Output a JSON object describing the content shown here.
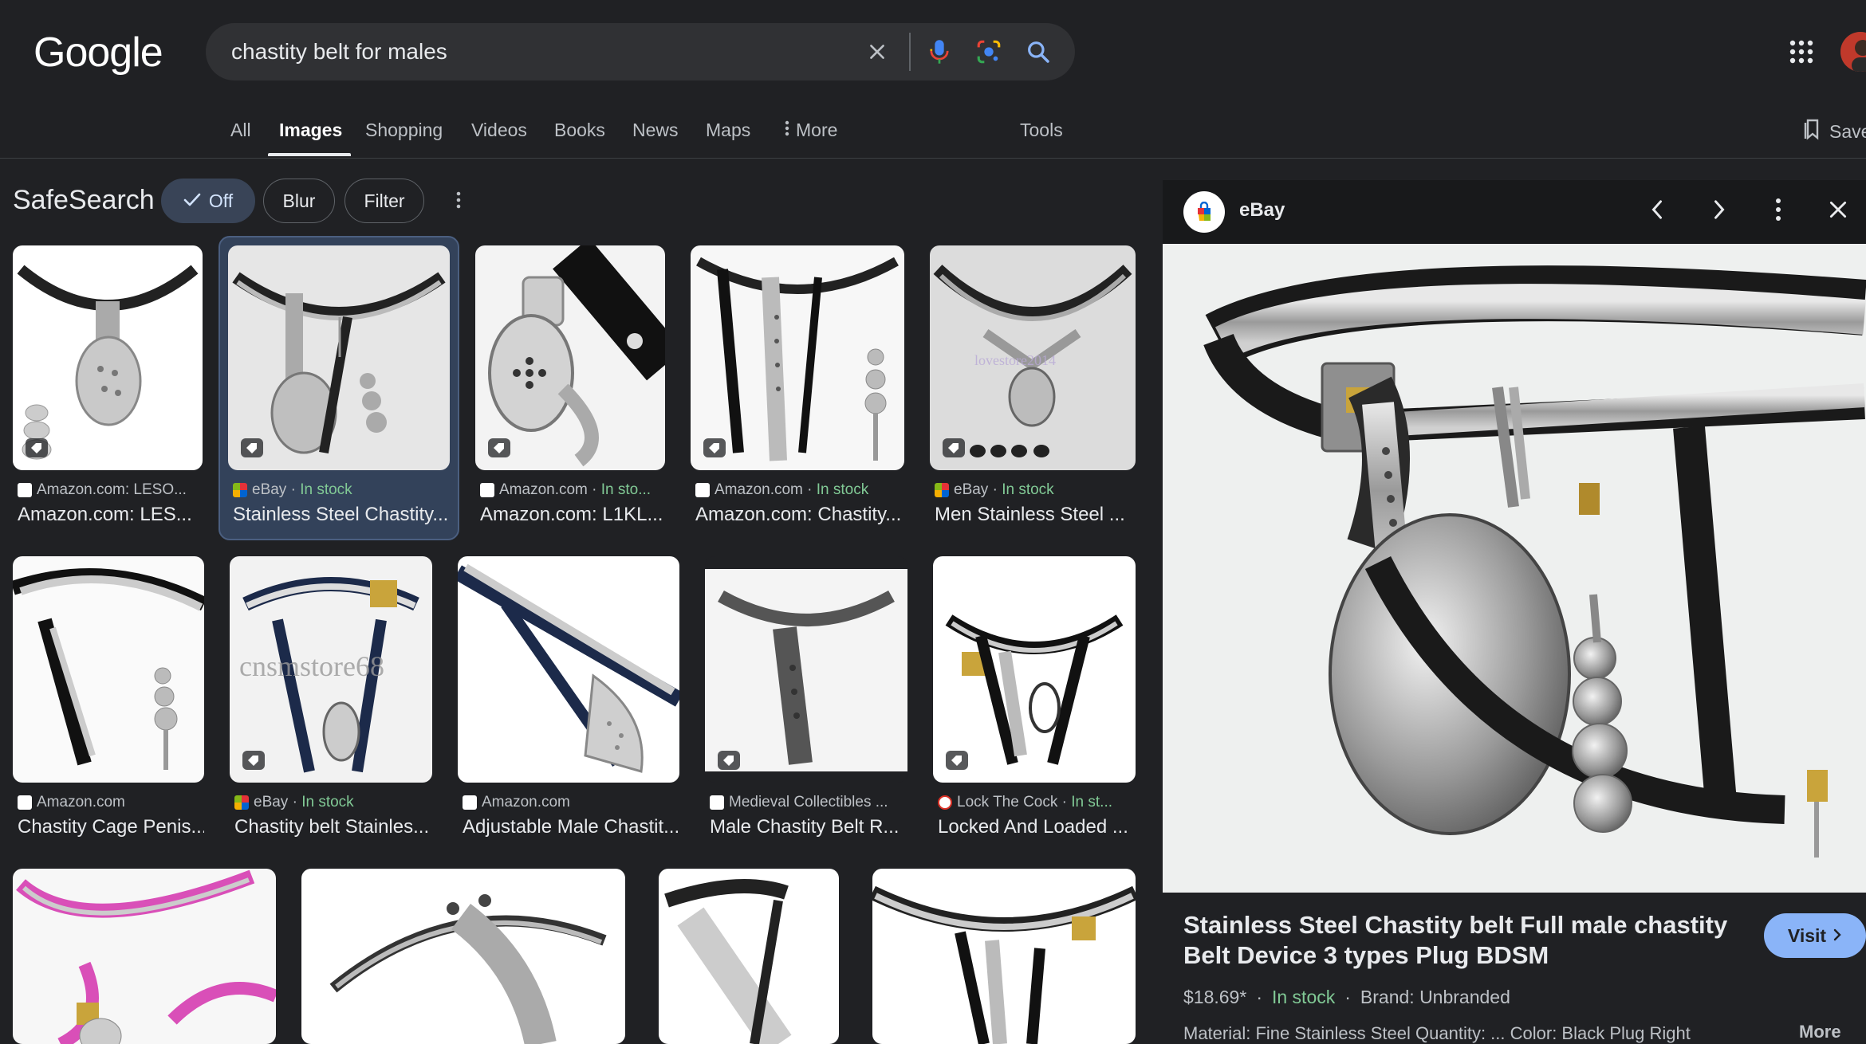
{
  "header": {
    "logo": "Google",
    "search_value": "chastity belt for males",
    "icons": [
      "close-icon",
      "microphone-icon",
      "lens-icon",
      "search-icon",
      "apps-grid-icon",
      "avatar"
    ]
  },
  "tabs": [
    {
      "label": "All",
      "active": false
    },
    {
      "label": "Images",
      "active": true
    },
    {
      "label": "Shopping",
      "active": false
    },
    {
      "label": "Videos",
      "active": false
    },
    {
      "label": "Books",
      "active": false
    },
    {
      "label": "News",
      "active": false
    },
    {
      "label": "Maps",
      "active": false
    },
    {
      "label": "More",
      "active": false
    },
    {
      "label": "Tools",
      "active": false
    }
  ],
  "save_label": "Save",
  "safesearch": {
    "title": "SafeSearch",
    "options": [
      "Off",
      "Blur",
      "Filter"
    ],
    "selected": "Off"
  },
  "results": [
    {
      "source": "Amazon.com: LESO...",
      "stock": "",
      "title": "Amazon.com: LES..."
    },
    {
      "source": "eBay · ",
      "stock": "In stock",
      "title": "Stainless Steel Chastity..."
    },
    {
      "source": "Amazon.com · ",
      "stock": "In sto...",
      "title": "Amazon.com: L1KL..."
    },
    {
      "source": "Amazon.com · ",
      "stock": "In stock",
      "title": "Amazon.com: Chastity..."
    },
    {
      "source": "eBay · ",
      "stock": "In stock",
      "title": "Men Stainless Steel ..."
    },
    {
      "source": "Amazon.com",
      "stock": "",
      "title": "Chastity Cage Penis..."
    },
    {
      "source": "eBay · ",
      "stock": "In stock",
      "title": "Chastity belt Stainles..."
    },
    {
      "source": "Amazon.com",
      "stock": "",
      "title": "Adjustable Male Chastit..."
    },
    {
      "source": "Medieval Collectibles ...",
      "stock": "",
      "title": "Male Chastity Belt R..."
    },
    {
      "source": "Lock The Cock · ",
      "stock": "In st...",
      "title": "Locked And Loaded ..."
    },
    {
      "source": "",
      "stock": "",
      "title": ""
    },
    {
      "source": "",
      "stock": "",
      "title": ""
    },
    {
      "source": "",
      "stock": "",
      "title": ""
    },
    {
      "source": "",
      "stock": "",
      "title": ""
    }
  ],
  "thumb_watermarks": {
    "r1c5": "lovestore2014",
    "r2c2": "cnsmstore68"
  },
  "panel": {
    "source": "eBay",
    "title": "Stainless Steel Chastity belt Full male chastity Belt Device 3 types Plug BDSM",
    "visit_label": "Visit",
    "price": "$18.69*",
    "stock": "In stock",
    "brand": "Brand: Unbranded",
    "description": "Material: Fine Stainless Steel Quantity: ... Color: Black Plug Right",
    "more_label": "More"
  },
  "colors": {
    "background": "#202124",
    "stock": "#81c995",
    "accent": "#8ab4f8"
  }
}
